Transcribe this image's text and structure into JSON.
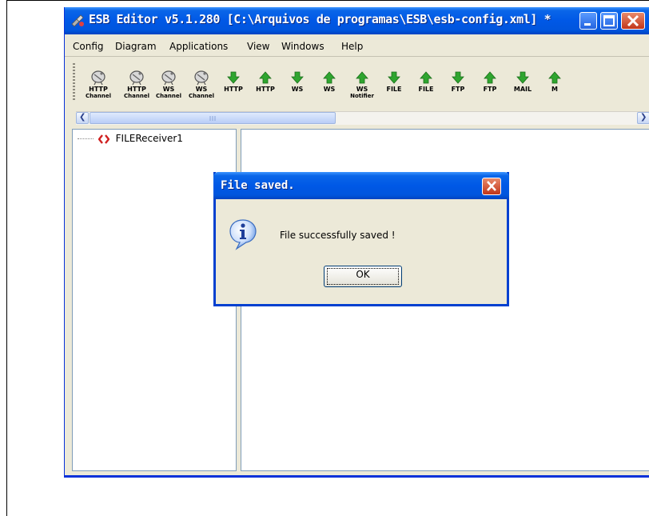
{
  "window": {
    "title": "ESB Editor v5.1.280 [C:\\Arquivos de programas\\ESB\\esb-config.xml] *"
  },
  "menu": [
    "Config",
    "Diagram",
    "Applications",
    "View",
    "Windows",
    "Help"
  ],
  "toolbar": {
    "tools": [
      {
        "label": "HTTP",
        "label2": "Channel",
        "icon": "satellite-dish-icon"
      },
      {
        "label": "HTTP",
        "label2": "Channel",
        "icon": "satellite-dish-icon"
      },
      {
        "label": "WS",
        "label2": "Channel",
        "icon": "satellite-dish-icon"
      },
      {
        "label": "WS",
        "label2": "Channel",
        "icon": "satellite-dish-icon"
      },
      {
        "label": "HTTP",
        "label2": "",
        "icon": "arrow-down-icon"
      },
      {
        "label": "HTTP",
        "label2": "",
        "icon": "arrow-up-icon"
      },
      {
        "label": "WS",
        "label2": "",
        "icon": "arrow-down-icon"
      },
      {
        "label": "WS",
        "label2": "",
        "icon": "arrow-up-icon"
      },
      {
        "label": "WS",
        "label2": "Notifier",
        "icon": "arrow-up-icon"
      },
      {
        "label": "FILE",
        "label2": "",
        "icon": "arrow-down-icon"
      },
      {
        "label": "FILE",
        "label2": "",
        "icon": "arrow-up-icon"
      },
      {
        "label": "FTP",
        "label2": "",
        "icon": "arrow-down-icon"
      },
      {
        "label": "FTP",
        "label2": "",
        "icon": "arrow-up-icon"
      },
      {
        "label": "MAIL",
        "label2": "",
        "icon": "arrow-down-icon"
      },
      {
        "label": "M",
        "label2": "",
        "icon": "arrow-up-icon"
      }
    ]
  },
  "tree": {
    "node_label": "FILEReceiver1"
  },
  "dialog": {
    "title": "File saved.",
    "message": "File successfully saved !",
    "ok_label": "OK"
  },
  "colors": {
    "titlebar": "#0058e6",
    "arrow_green": "#2fa52f",
    "window_bg": "#ece9d8"
  }
}
